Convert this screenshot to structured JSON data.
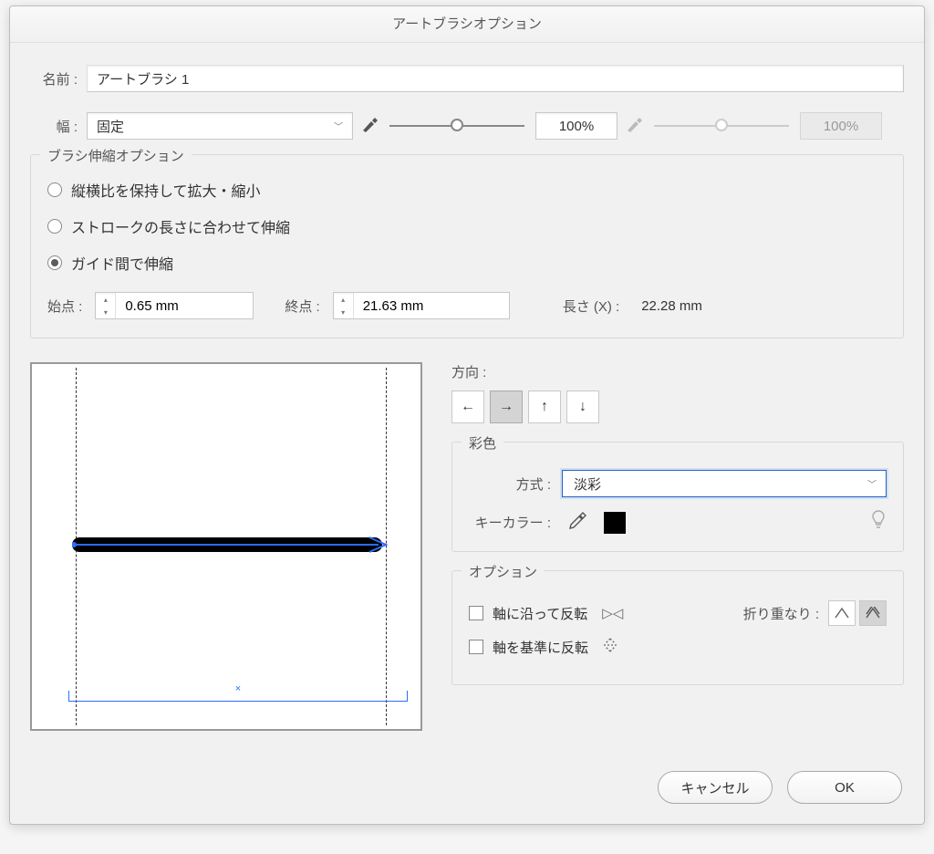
{
  "title": "アートブラシオプション",
  "name": {
    "label": "名前 :",
    "value": "アートブラシ 1"
  },
  "width": {
    "label": "幅 :",
    "mode": "固定",
    "value1": "100%",
    "value2": "100%"
  },
  "scaleOptions": {
    "legend": "ブラシ伸縮オプション",
    "r1": "縦横比を保持して拡大・縮小",
    "r2": "ストロークの長さに合わせて伸縮",
    "r3": "ガイド間で伸縮",
    "startLbl": "始点 :",
    "startVal": "0.65 mm",
    "endLbl": "終点 :",
    "endVal": "21.63 mm",
    "lenLbl": "長さ (X) :",
    "lenVal": "22.28 mm"
  },
  "direction": {
    "label": "方向 :"
  },
  "colorization": {
    "legend": "彩色",
    "methodLbl": "方式 :",
    "method": "淡彩",
    "keyLbl": "キーカラー :"
  },
  "options": {
    "legend": "オプション",
    "flipAlong": "軸に沿って反転",
    "flipAcross": "軸を基準に反転",
    "overlapLbl": "折り重なり :"
  },
  "buttons": {
    "cancel": "キャンセル",
    "ok": "OK"
  }
}
